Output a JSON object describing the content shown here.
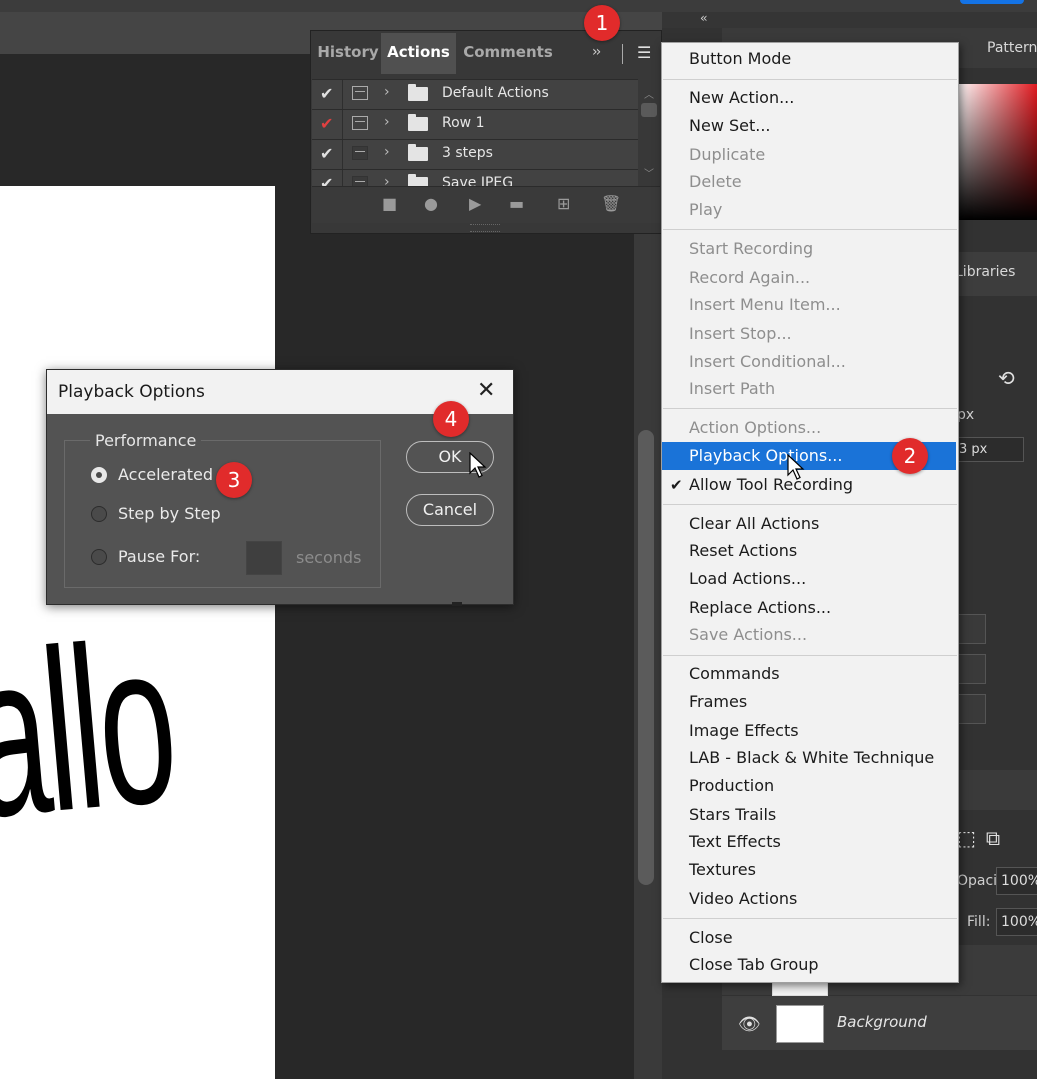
{
  "actions_panel": {
    "tabs": [
      "History",
      "Actions",
      "Comments"
    ],
    "expand_icon": "double-chevron-right-icon",
    "menu_icon": "hamburger-menu-icon",
    "rows": [
      {
        "label": "Default Actions",
        "checked": true,
        "dialog": true
      },
      {
        "label": "Row 1",
        "checked": true,
        "check_color": "#e04040",
        "dialog": true
      },
      {
        "label": "3 steps",
        "checked": true,
        "dialog": false
      },
      {
        "label": "Save JPEG",
        "checked": true,
        "dialog": false
      }
    ],
    "footer_icons": [
      "stop-icon",
      "record-icon",
      "play-icon",
      "folder-icon",
      "new-action-icon",
      "trash-icon"
    ]
  },
  "menu": {
    "items": {
      "button_mode": "Button Mode",
      "new_action": "New Action...",
      "new_set": "New Set...",
      "duplicate": "Duplicate",
      "delete": "Delete",
      "play": "Play",
      "start_recording": "Start Recording",
      "record_again": "Record Again...",
      "insert_menu_item": "Insert Menu Item...",
      "insert_stop": "Insert Stop...",
      "insert_conditional": "Insert Conditional...",
      "insert_path": "Insert Path",
      "action_options": "Action Options...",
      "playback_options": "Playback Options...",
      "allow_tool_recording": "Allow Tool Recording",
      "clear_all_actions": "Clear All Actions",
      "reset_actions": "Reset Actions",
      "load_actions": "Load Actions...",
      "replace_actions": "Replace Actions...",
      "save_actions": "Save Actions...",
      "commands": "Commands",
      "frames": "Frames",
      "image_effects": "Image Effects",
      "lab_bw": "LAB - Black & White Technique",
      "production": "Production",
      "stars_trails": "Stars Trails",
      "text_effects": "Text Effects",
      "textures": "Textures",
      "video_actions": "Video Actions",
      "close": "Close",
      "close_tab_group": "Close Tab Group"
    },
    "checkmark": "✔",
    "highlight_color": "#1a73d8"
  },
  "dialog": {
    "title": "Playback Options",
    "group": "Performance",
    "options": {
      "accelerated": "Accelerated",
      "step_by_step": "Step by Step",
      "pause_for": "Pause For:"
    },
    "selected": "Accelerated",
    "pause_value": "",
    "seconds_label": "seconds",
    "ok": "OK",
    "cancel": "Cancel"
  },
  "callouts": [
    "1",
    "2",
    "3",
    "4"
  ],
  "callout_color": "#e12b2b",
  "right_panel": {
    "patterns_tab": "Patterns",
    "libraries_tab": "Libraries",
    "px_label": "px",
    "px_value": "3 px",
    "opacity_label": "Opacity:",
    "opacity_value": "100%",
    "fill_label": "Fill:",
    "fill_value": "100%",
    "background_layer": "Background"
  },
  "document": {
    "canvas_text": "allo"
  }
}
